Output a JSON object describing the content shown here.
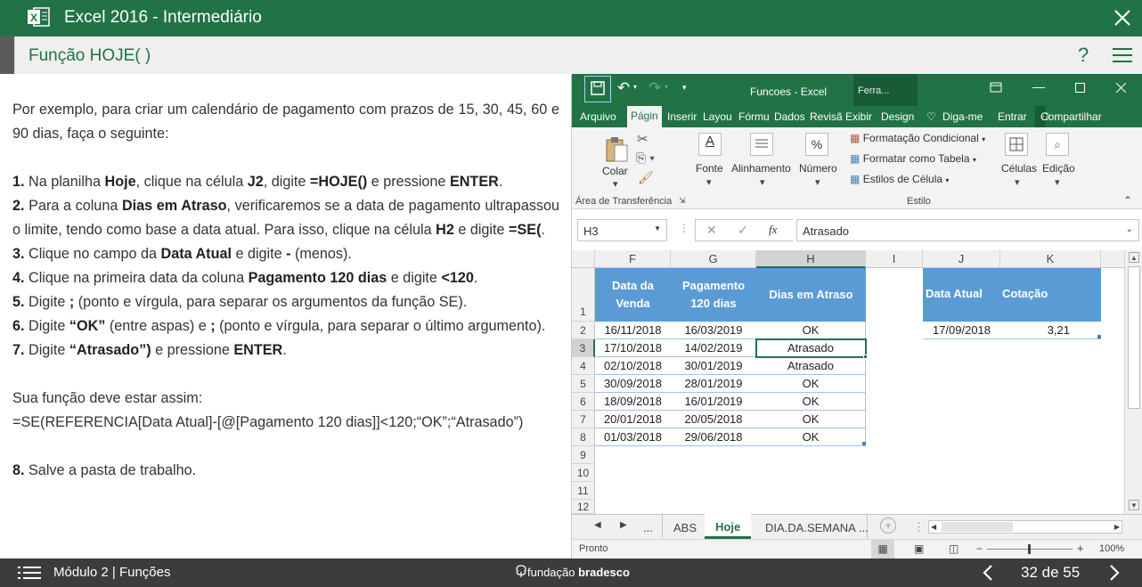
{
  "app": {
    "title": "Excel 2016 - Intermediário",
    "subtitle": "Função HOJE( )",
    "help": "?"
  },
  "lesson": {
    "intro": "Por exemplo, para criar um calendário de pagamento com prazos de 15, 30, 45, 60 e 90 dias, faça o seguinte:",
    "steps": [
      [
        "1.",
        " Na planilha ",
        "Hoje",
        ", clique na célula ",
        "J2",
        ", digite ",
        "=HOJE()",
        " e pressione ",
        "ENTER",
        "."
      ],
      [
        "2.",
        " Para a coluna ",
        "Dias em Atraso",
        ", verificaremos se a data de pagamento ultrapassou o limite, tendo como base a data atual. Para isso, clique na célula ",
        "H2",
        " e digite ",
        "=SE(",
        "."
      ],
      [
        "3.",
        " Clique no campo da ",
        "Data Atual",
        " e digite ",
        "-",
        " (menos)."
      ],
      [
        "4.",
        " Clique na primeira data da coluna ",
        "Pagamento 120 dias",
        " e digite ",
        "<120",
        "."
      ],
      [
        "5.",
        " Digite ",
        ";",
        " (ponto e vírgula, para separar os argumentos da função SE)."
      ],
      [
        "6.",
        " Digite ",
        "“OK”",
        " (entre aspas) e ",
        ";",
        " (ponto e vírgula, para separar o último argumento)."
      ],
      [
        "7.",
        " Digite ",
        "“Atrasado”)",
        " e pressione ",
        "ENTER",
        "."
      ]
    ],
    "result_label": "Sua função deve estar assim:",
    "formula": "=SE(REFERENCIA[Data Atual]-[@[Pagamento 120 dias]]<120;“OK”;“Atrasado”)",
    "step8": [
      "8.",
      " Salve a pasta de trabalho."
    ]
  },
  "excel": {
    "file_title": "Funcoes - Excel",
    "ferra_tab": "Ferra...",
    "menu": [
      "Arquivo",
      "Págin",
      "Inserir",
      "Layou",
      "Fórmu",
      "Dados",
      "Revisã",
      "Exibir",
      "Design"
    ],
    "tell_me": "Diga-me",
    "enter": "Entrar",
    "share": "Compartilhar",
    "ribbon": {
      "colar": "Colar",
      "fonte": "Fonte",
      "alinhamento": "Alinhamento",
      "numero": "Número",
      "cond_format": "Formatação Condicional",
      "format_table": "Formatar como Tabela",
      "cell_styles": "Estilos de Célula",
      "celulas": "Células",
      "edicao": "Edição",
      "clipboard": "Área de Transferência",
      "estilo": "Estilo"
    },
    "name_box": "H3",
    "formula_value": "Atrasado",
    "fx": "fx",
    "columns": [
      "F",
      "G",
      "H",
      "I",
      "J",
      "K"
    ],
    "rows": [
      "1",
      "2",
      "3",
      "4",
      "5",
      "6",
      "7",
      "8",
      "9",
      "10",
      "11",
      "12"
    ],
    "table_headers": [
      "Data da Venda",
      "Pagamento 120 dias",
      "Dias em Atraso"
    ],
    "table_rows": [
      [
        "16/11/2018",
        "16/03/2019",
        "OK"
      ],
      [
        "17/10/2018",
        "14/02/2019",
        "Atrasado"
      ],
      [
        "02/10/2018",
        "30/01/2019",
        "Atrasado"
      ],
      [
        "30/09/2018",
        "28/01/2019",
        "OK"
      ],
      [
        "18/09/2018",
        "16/01/2019",
        "OK"
      ],
      [
        "20/01/2018",
        "20/05/2018",
        "OK"
      ],
      [
        "01/03/2018",
        "29/06/2018",
        "OK"
      ]
    ],
    "side_headers": [
      "Data Atual",
      "Cotação"
    ],
    "side_values": [
      "17/09/2018",
      "3,21"
    ],
    "sheets": [
      "...",
      "ABS",
      "Hoje",
      "DIA.DA.SEMANA",
      "..."
    ],
    "status": "Pronto",
    "zoom": "100%"
  },
  "footer": {
    "module": "Módulo 2 | Funções",
    "brand_a": "fundação ",
    "brand_b": "bradesco",
    "page": "32 de 55"
  },
  "colors": {
    "excel_green": "#217346",
    "table_blue": "#5b9bd5"
  }
}
